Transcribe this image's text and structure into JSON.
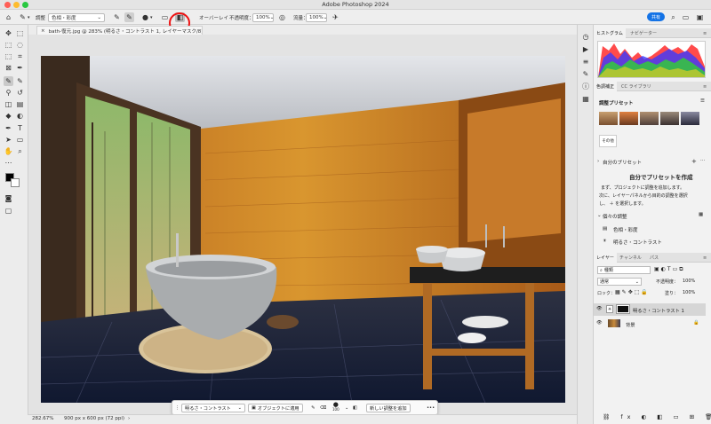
{
  "window": {
    "title": "Adobe Photoshop 2024"
  },
  "options_bar": {
    "preset_label": "調整",
    "preset_value": "色相・彩度",
    "blend_label": "オーバーレイ",
    "opacity_label": "不透明度：",
    "opacity_value": "100%",
    "flow_label": "流量：",
    "flow_value": "100%",
    "share_label": "共有"
  },
  "document": {
    "tab_title": "bath-復元.jpg @ 283% (明るさ・コントラスト 1, レイヤーマスク/8) *"
  },
  "status": {
    "zoom": "282.67%",
    "doc_size": "900 px x 600 px (72 ppi)"
  },
  "context_bar": {
    "adjustment_select": "明るさ・コントラスト",
    "apply_button": "オブジェクトに適用",
    "brush_size": "100",
    "new_adjustment_button": "新しい調整を追加",
    "more": "•••"
  },
  "panels": {
    "top_tabs": [
      "ヒストグラム",
      "ナビゲーター"
    ],
    "adjust_tabs": [
      "色調補正",
      "CC ライブラリ"
    ],
    "presets_header": "調整プリセット",
    "presets_more": "その他",
    "my_presets_header": "自分のプリセット",
    "create_title": "自分でプリセットを作成",
    "create_desc_1": "まず、プロジェクトに調整を追加します。",
    "create_desc_2": "次に、レイヤーパネルから目的の調整を選択",
    "create_desc_3": "し、 ＋ を選択します。",
    "single_header": "個々の調整",
    "single_items": [
      "色相・彩度",
      "明るさ・コントラスト"
    ],
    "layers_tabs": [
      "レイヤー",
      "チャンネル",
      "パス"
    ],
    "filter_label": "種類",
    "blend_mode": "通常",
    "opacity_label": "不透明度：",
    "opacity_value": "100%",
    "lock_label": "ロック：",
    "fill_label": "塗り：",
    "fill_value": "100%",
    "layers": [
      "明るさ・コントラスト 1",
      "背景"
    ]
  },
  "colors": {
    "accent": "#1473e6",
    "highlight": "#e11111",
    "wood": "#c9822f"
  }
}
